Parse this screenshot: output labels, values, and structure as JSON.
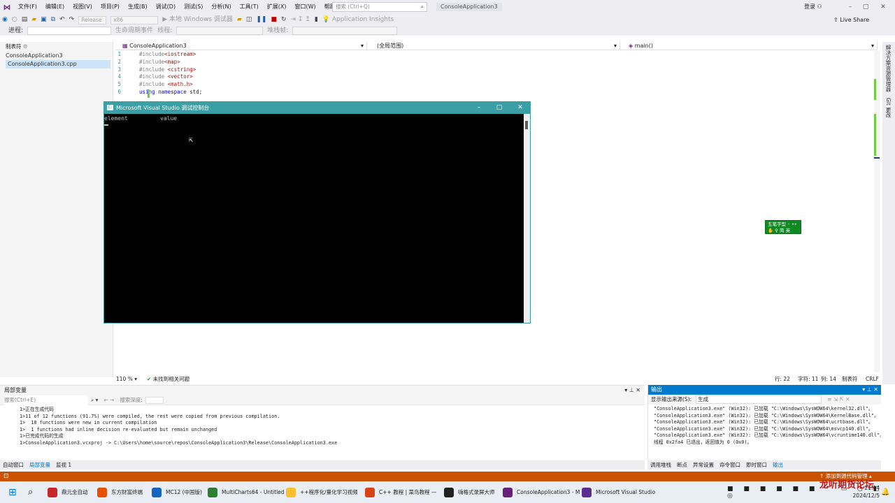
{
  "menubar": {
    "items": [
      "文件(F)",
      "编辑(E)",
      "视图(V)",
      "项目(P)",
      "生成(B)",
      "调试(D)",
      "测试(S)",
      "分析(N)",
      "工具(T)",
      "扩展(X)",
      "窗口(W)",
      "帮助(H)"
    ],
    "search_placeholder": "搜索 (Ctrl+Q)",
    "solution_name": "ConsoleApplication3",
    "login": "登录"
  },
  "toolbar": {
    "config": "Release",
    "platform": "x86",
    "debugger": "本地 Windows 调试器",
    "insights": "Application Insights",
    "live_share": "Live Share",
    "process_label": "进程:",
    "lifecycle": "生命周期事件",
    "thread": "线程:",
    "stack_frame": "堆栈帧:"
  },
  "sidepanel": {
    "title": "制表符",
    "items": [
      "ConsoleApplication3",
      "ConsoleApplication3.cpp"
    ]
  },
  "editor": {
    "project_combo": "ConsoleApplication3",
    "scope_combo": "(全局范围)",
    "function_combo": "main()",
    "zoom": "110 %",
    "issues": "未找到相关问题",
    "position": {
      "line": "行: 22",
      "char": "字符: 11",
      "col": "列: 14",
      "tabs": "制表符",
      "eol": "CRLF"
    },
    "lines": [
      {
        "n": "1",
        "pp": "#include",
        "arg": "<iostream>"
      },
      {
        "n": "2",
        "pp": "#include",
        "arg": "<map>"
      },
      {
        "n": "3",
        "pp": "#include",
        "arg": " <cstring>"
      },
      {
        "n": "4",
        "pp": "#include",
        "arg": " <vector>"
      },
      {
        "n": "5",
        "pp": "#include",
        "arg": " <math.h>"
      },
      {
        "n": "6",
        "kw1": "using",
        "kw2": "namespace",
        "rest": "std;"
      }
    ]
  },
  "right_rail": [
    "解决方案资源管理器",
    "Git 更改"
  ],
  "console": {
    "title": "Microsoft Visual Studio 调试控制台",
    "header_col1": "element",
    "header_col2": "value"
  },
  "ime": {
    "line1": "五笔字型",
    "line2": "简 英"
  },
  "locals_panel": {
    "title": "局部变量",
    "search_placeholder": "搜索(Ctrl+E)",
    "search_depth_label": "搜索深度:",
    "output_lines": [
      "1>正在生成代码",
      "1>11 of 12 functions (91.7%) were compiled, the rest were copied from previous compilation.",
      "1>  10 functions were new in current compilation",
      "1>  1 functions had inline decision re-evaluated but remain unchanged",
      "1>已完成代码的生成",
      "1>ConsoleApplication3.vcxproj -> C:\\Users\\home\\source\\repos\\ConsoleApplication3\\Release\\ConsoleApplication3.exe"
    ],
    "tabs": [
      "自动窗口",
      "局部变量",
      "监视 1"
    ]
  },
  "output_panel": {
    "title": "输出",
    "source_label": "显示输出来源(S):",
    "source_value": "生成",
    "lines": [
      "\"ConsoleApplication3.exe\" (Win32): 已加载 \"C:\\Windows\\SysWOW64\\kernel32.dll\"。",
      "\"ConsoleApplication3.exe\" (Win32): 已加载 \"C:\\Windows\\SysWOW64\\KernelBase.dll\"。",
      "\"ConsoleApplication3.exe\" (Win32): 已加载 \"C:\\Windows\\SysWOW64\\ucrtbase.dll\"。",
      "\"ConsoleApplication3.exe\" (Win32): 已加载 \"C:\\Windows\\SysWOW64\\msvcp140.dll\"。",
      "\"ConsoleApplication3.exe\" (Win32): 已加载 \"C:\\Windows\\SysWOW64\\vcruntime140.dll\"。",
      "线程 0x2fa4 已退出，返回值为 0 (0x0)。"
    ],
    "tabs": [
      "调用堆栈",
      "断点",
      "异常设置",
      "命令窗口",
      "即时窗口",
      "输出"
    ]
  },
  "statusbar": {
    "add_source": "添加到源代码管理"
  },
  "taskbar": {
    "apps": [
      {
        "label": "鼎元全自动",
        "color": "#c62828"
      },
      {
        "label": "东方财富终端",
        "color": "#e65100"
      },
      {
        "label": "MC12 (中国版)",
        "color": "#1565c0"
      },
      {
        "label": "MultiCharts64 - Untitled",
        "color": "#2e7d32"
      },
      {
        "label": "++程序化/量化学习视频",
        "color": "#fbc02d"
      },
      {
        "label": "C++ 教程 | 菜鸟教程 —",
        "color": "#d84315"
      },
      {
        "label": "嗨格式录屏大师",
        "color": "#212121"
      },
      {
        "label": "ConsoleApplication3 - M",
        "color": "#68217a"
      },
      {
        "label": "Microsoft Visual Studio",
        "color": "#5c2d91"
      }
    ],
    "time": "21:14",
    "date": "2024/12/5"
  },
  "watermark": "龙听期货论坛"
}
